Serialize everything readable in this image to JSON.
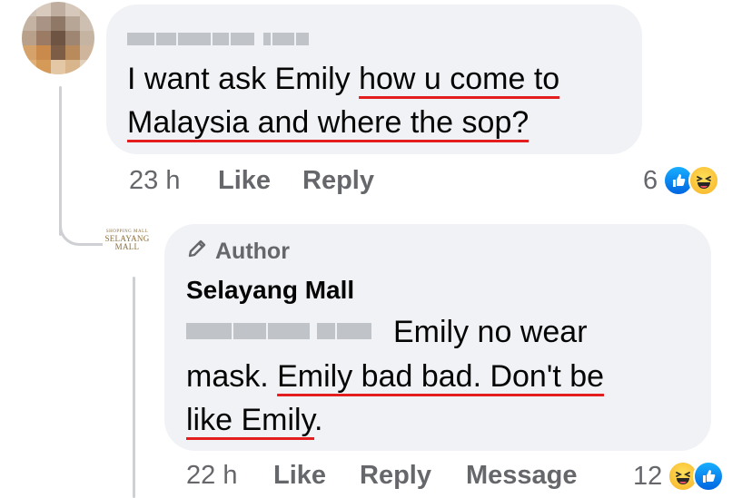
{
  "comment": {
    "author_blurred": true,
    "line1_plain": "I want ask Emily ",
    "line1_underlined": "how u come to",
    "line2_underlined": "Malaysia and where the sop?",
    "time": "23 h",
    "like_label": "Like",
    "reply_label": "Reply",
    "reaction_count": "6",
    "reactions": [
      "like-icon",
      "haha-icon"
    ]
  },
  "reply": {
    "badge": "Author",
    "author": "Selayang Mall",
    "avatar": {
      "top_text": "SHOPPING MALL",
      "name_text": "SELAYANG MALL"
    },
    "line1_plain": " Emily no wear",
    "line2_plain": "mask. ",
    "line2_underlined": "Emily bad bad. Don't be",
    "line3_underlined": "like Emily",
    "line3_plain": ".",
    "time": "22 h",
    "like_label": "Like",
    "reply_label": "Reply",
    "message_label": "Message",
    "reaction_count": "12",
    "reactions": [
      "haha-icon",
      "like-icon"
    ]
  },
  "colors": {
    "bubble": "#f0f2f5",
    "meta_text": "#65676b",
    "underline": "#e41e1e",
    "like_blue": "#0866ff",
    "haha_yellow": "#f7b125"
  }
}
